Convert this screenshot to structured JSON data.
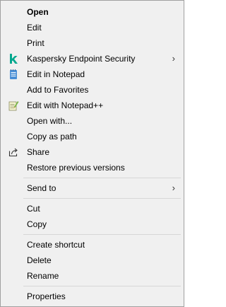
{
  "menu": {
    "items": [
      {
        "label": "Open"
      },
      {
        "label": "Edit"
      },
      {
        "label": "Print"
      },
      {
        "label": "Kaspersky Endpoint Security",
        "arrow": "›"
      },
      {
        "label": "Edit in Notepad"
      },
      {
        "label": "Add to Favorites"
      },
      {
        "label": "Edit with Notepad++"
      },
      {
        "label": "Open with..."
      },
      {
        "label": "Copy as path"
      },
      {
        "label": "Share"
      },
      {
        "label": "Restore previous versions"
      },
      {
        "label": "Send to",
        "arrow": "›"
      },
      {
        "label": "Cut"
      },
      {
        "label": "Copy"
      },
      {
        "label": "Create shortcut"
      },
      {
        "label": "Delete"
      },
      {
        "label": "Rename"
      },
      {
        "label": "Properties"
      }
    ]
  },
  "icons": {
    "kaspersky": "kaspersky-icon",
    "notepad": "notepad-icon",
    "notepadpp": "notepad-plus-plus-icon",
    "share": "share-icon"
  },
  "colors": {
    "menu_bg": "#f0f0f0",
    "border": "#a0a0a0",
    "kaspersky_green": "#00a88e"
  }
}
